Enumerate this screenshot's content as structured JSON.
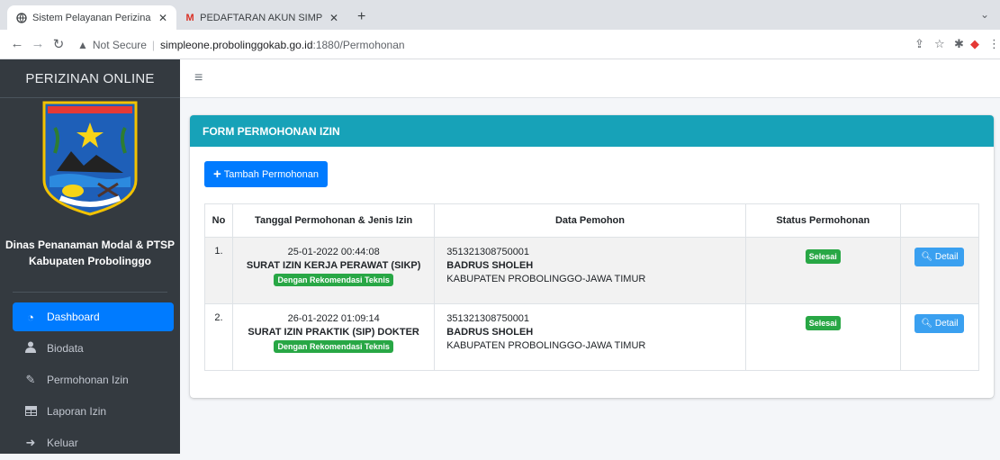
{
  "browser": {
    "tabs": [
      {
        "title": "Sistem Pelayanan Perizinan On",
        "icon": "globe-icon",
        "active": true
      },
      {
        "title": "PEDAFTARAN AKUN SIMPLE O",
        "icon": "gmail-icon",
        "active": false
      }
    ],
    "url_security": "Not Secure",
    "url_host": "simpleone.probolinggokab.go.id",
    "url_path": ":1880/Permohonan"
  },
  "sidebar": {
    "brand": "PERIZINAN ONLINE",
    "agency_line1": "Dinas Penanaman Modal & PTSP",
    "agency_line2": "Kabupaten Probolinggo",
    "items": [
      {
        "label": "Dashboard",
        "icon": "dashboard-icon",
        "active": true
      },
      {
        "label": "Biodata",
        "icon": "user-icon",
        "active": false
      },
      {
        "label": "Permohonan Izin",
        "icon": "edit-icon",
        "active": false
      },
      {
        "label": "Laporan Izin",
        "icon": "table-icon",
        "active": false
      },
      {
        "label": "Keluar",
        "icon": "sign-out-icon",
        "active": false
      }
    ]
  },
  "main": {
    "card_title": "FORM PERMOHONAN IZIN",
    "add_button": "Tambah Permohonan",
    "table": {
      "headers": [
        "No",
        "Tanggal Permohonan & Jenis Izin",
        "Data Pemohon",
        "Status Permohonan",
        ""
      ],
      "rows": [
        {
          "no": "1.",
          "tanggal": "25-01-2022 00:44:08",
          "jenis": "SURAT IZIN KERJA PERAWAT (SIKP)",
          "rekomendasi": "Dengan Rekomendasi Teknis",
          "nik": "351321308750001",
          "nama": "BADRUS SHOLEH",
          "alamat": "KABUPATEN PROBOLINGGO-JAWA TIMUR",
          "status": "Selesai",
          "action": "Detail"
        },
        {
          "no": "2.",
          "tanggal": "26-01-2022 01:09:14",
          "jenis": "SURAT IZIN PRAKTIK (SIP) DOKTER",
          "rekomendasi": "Dengan Rekomendasi Teknis",
          "nik": "351321308750001",
          "nama": "BADRUS SHOLEH",
          "alamat": "KABUPATEN PROBOLINGGO-JAWA TIMUR",
          "status": "Selesai",
          "action": "Detail"
        }
      ]
    }
  },
  "colors": {
    "sidebar_bg": "#343a40",
    "card_header": "#17a2b8",
    "primary": "#007bff",
    "success": "#28a745"
  }
}
